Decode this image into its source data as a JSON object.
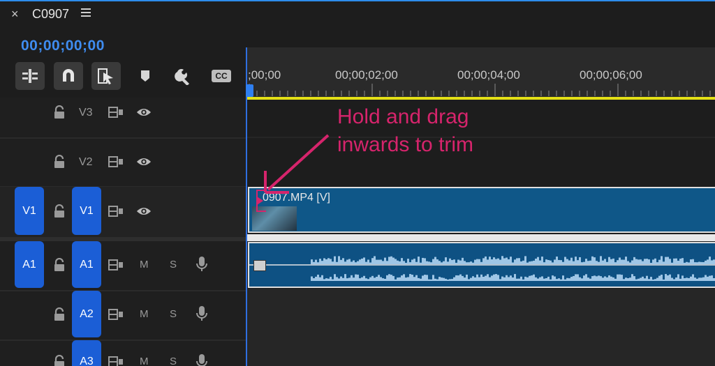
{
  "sequence": {
    "close_glyph": "×",
    "name": "C0907",
    "menu_icon": "hamburger-menu-icon"
  },
  "timecode": "00;00;00;00",
  "toolbar": {
    "tools": [
      {
        "name": "insert-nest-icon",
        "active": true
      },
      {
        "name": "snap-magnet-icon",
        "active": true
      },
      {
        "name": "linked-selection-icon",
        "active": true
      },
      {
        "name": "add-marker-icon",
        "active": false
      },
      {
        "name": "settings-wrench-icon",
        "active": false
      },
      {
        "name": "captions-cc-icon",
        "active": false
      }
    ],
    "cc_label": "CC"
  },
  "ruler": {
    "labels": [
      ";00;00",
      "00;00;02;00",
      "00;00;04;00",
      "00;00;06;00"
    ]
  },
  "tracks": {
    "video": [
      {
        "label": "V3",
        "source": null
      },
      {
        "label": "V2",
        "source": null
      },
      {
        "label": "V1",
        "source": "V1"
      }
    ],
    "audio": [
      {
        "label": "A1",
        "source": "A1",
        "m": "M",
        "s": "S"
      },
      {
        "label": "A2",
        "source": null,
        "m": "M",
        "s": "S"
      },
      {
        "label": "A3",
        "source": null,
        "m": "M",
        "s": "S"
      }
    ]
  },
  "clip": {
    "label": "0907.MP4 [V]"
  },
  "annotation": {
    "line1": "Hold and drag",
    "line2": "inwards to trim",
    "color": "#d6246c"
  },
  "colors": {
    "accent": "#1b5ed6",
    "timecode": "#3f8cf0",
    "work_area": "#e4e016",
    "clip_video": "#0f5788",
    "clip_audio": "#0e5183"
  }
}
